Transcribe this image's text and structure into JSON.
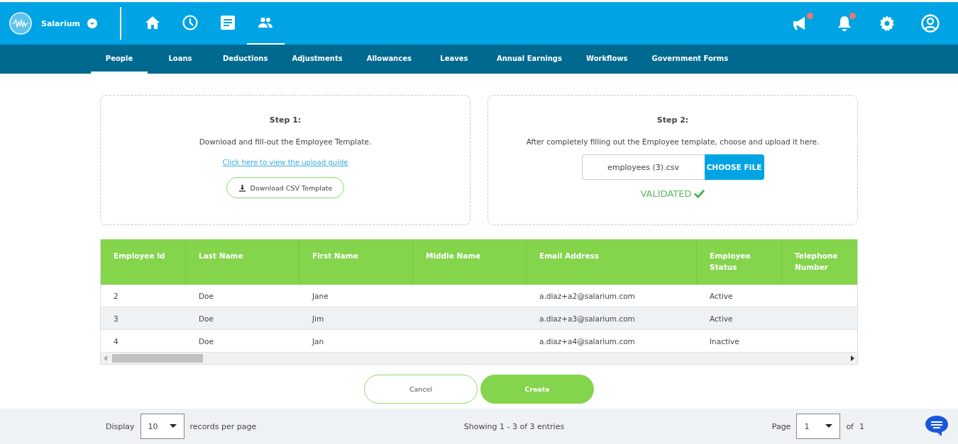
{
  "header": {
    "brand": "Salarium",
    "nav_icons": [
      {
        "kind": "home",
        "selected": false
      },
      {
        "kind": "clock",
        "selected": false
      },
      {
        "kind": "document",
        "selected": false
      },
      {
        "kind": "people",
        "selected": true
      }
    ],
    "actions": [
      {
        "kind": "megaphone",
        "notification": true
      },
      {
        "kind": "bell",
        "notification": true
      },
      {
        "kind": "settings",
        "notification": false
      },
      {
        "kind": "user",
        "notification": false
      }
    ]
  },
  "tabs": [
    {
      "label": "People",
      "selected": true
    },
    {
      "label": "Loans",
      "selected": false
    },
    {
      "label": "Deductions",
      "selected": false
    },
    {
      "label": "Adjustments",
      "selected": false
    },
    {
      "label": "Allowances",
      "selected": false
    },
    {
      "label": "Leaves",
      "selected": false
    },
    {
      "label": "Annual Earnings",
      "selected": false
    },
    {
      "label": "Workflows",
      "selected": false
    },
    {
      "label": "Government Forms",
      "selected": false
    }
  ],
  "step1": {
    "title": "Step 1:",
    "text": "Download and fill-out the Employee Template.",
    "link": "Click here to view the upload guide",
    "button": "Download CSV Template"
  },
  "step2": {
    "title": "Step 2:",
    "text": "After completely filling out the Employee template, choose and upload it here.",
    "file": "employees (3).csv",
    "button": "CHOOSE FILE",
    "status": "VALIDATED",
    "validated": true
  },
  "table": {
    "columns": [
      "Employee Id",
      "Last Name",
      "First Name",
      "Middle Name",
      "Email Address",
      "Employee Status",
      "Telephone Number"
    ],
    "rows": [
      [
        "2",
        "Doe",
        "Jane",
        "",
        "a.diaz+a2@salarium.com",
        "Active",
        ""
      ],
      [
        "3",
        "Doe",
        "Jim",
        "",
        "a.diaz+a3@salarium.com",
        "Active",
        ""
      ],
      [
        "4",
        "Doe",
        "Jan",
        "",
        "a.diaz+a4@salarium.com",
        "Inactive",
        ""
      ]
    ]
  },
  "buttons": {
    "cancel": "Cancel",
    "create": "Create"
  },
  "footer": {
    "display_label": "Display",
    "page_size": "10",
    "records_label": "records per page",
    "showing": "Showing 1 - 3 of 3 entries",
    "page_label": "Page",
    "page": "1",
    "of_label": "of",
    "total_pages": "1"
  }
}
